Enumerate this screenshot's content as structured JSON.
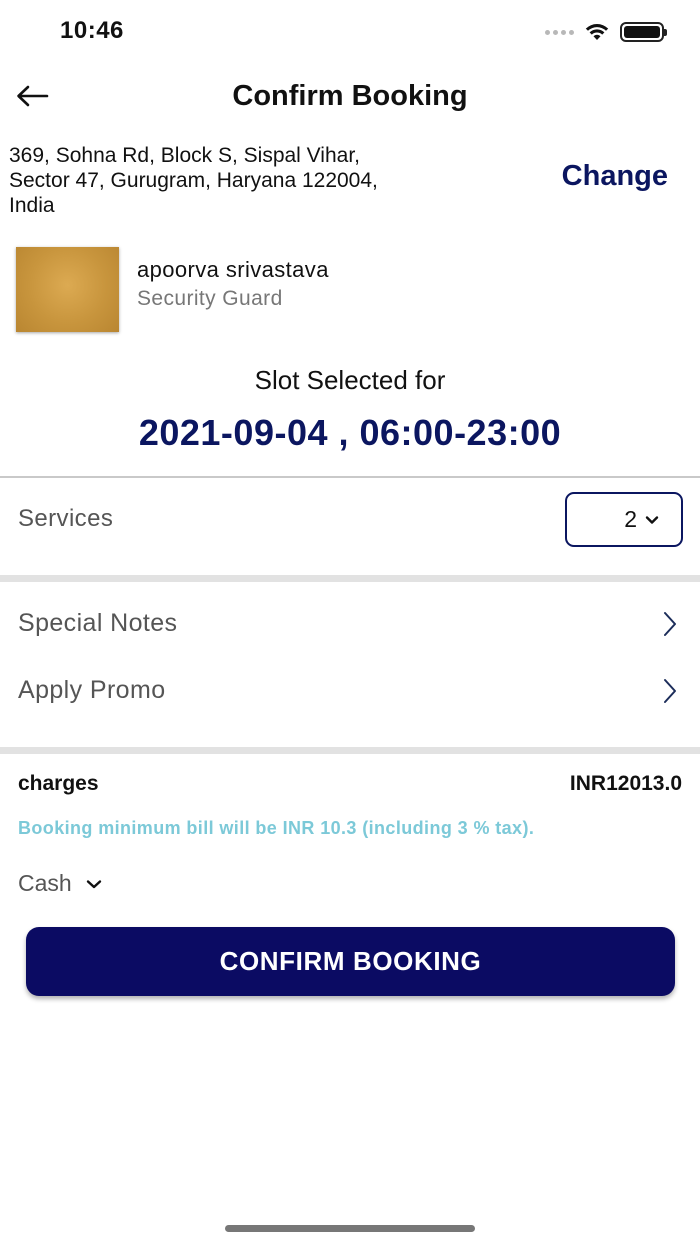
{
  "status_bar": {
    "time": "10:46"
  },
  "header": {
    "title": "Confirm Booking",
    "back_icon": "arrow-left-icon"
  },
  "address": {
    "lines": [
      "369, Sohna Rd, Block S, Sispal Vihar,",
      "Sector 47, Gurugram, Haryana 122004,",
      "India"
    ],
    "change_label": "Change"
  },
  "provider": {
    "name": "apoorva srivastava",
    "role": "Security Guard"
  },
  "slot": {
    "label": "Slot Selected for",
    "value": "2021-09-04 , 06:00-23:00"
  },
  "services": {
    "label": "Services",
    "selected": "2"
  },
  "options": {
    "special_notes": "Special Notes",
    "apply_promo": "Apply Promo"
  },
  "charges": {
    "label": "charges",
    "value": "INR12013.0",
    "min_bill_note": "Booking minimum bill will be INR 10.3 (including 3 % tax)."
  },
  "payment": {
    "method": "Cash"
  },
  "confirm_button": {
    "label": "CONFIRM BOOKING"
  },
  "colors": {
    "brand": "#0b1660",
    "button": "#0b0b63",
    "note": "#7cc9d8"
  }
}
